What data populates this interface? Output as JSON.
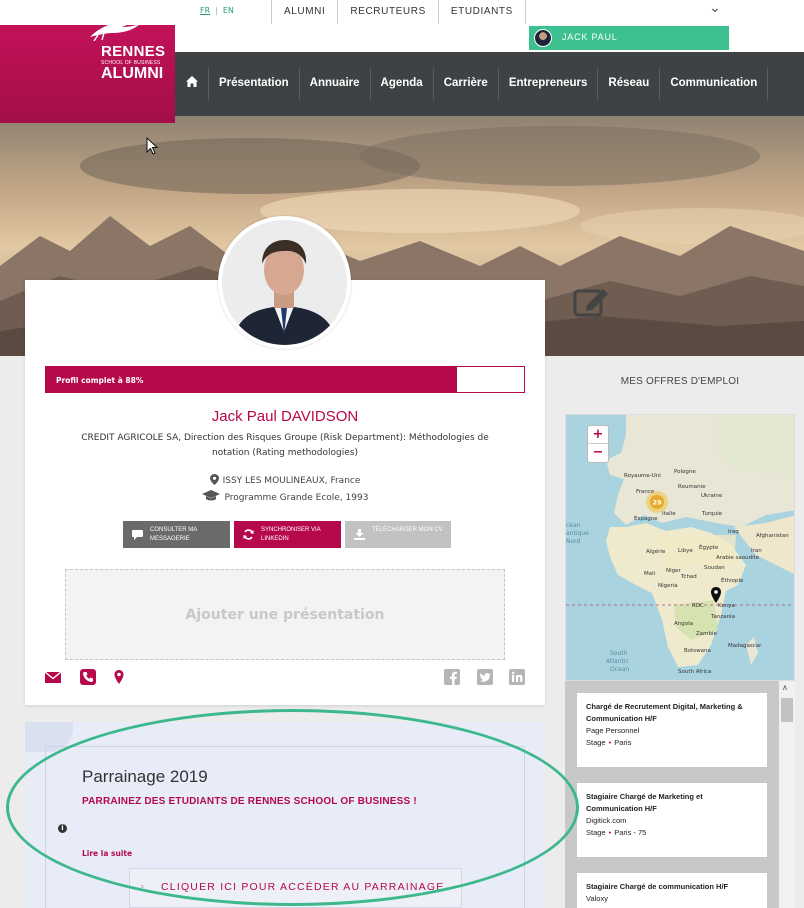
{
  "lang": {
    "fr": "FR",
    "sep": "|",
    "en": "EN"
  },
  "topnav": [
    "ALUMNI",
    "RECRUTEURS",
    "ETUDIANTS"
  ],
  "user": {
    "name": "JACK PAUL"
  },
  "logo": {
    "line1": "RENNES",
    "line2": "SCHOOL OF BUSINESS",
    "line3": "ALUMNI"
  },
  "mainnav": {
    "home_icon": "home-icon",
    "items": [
      "Présentation",
      "Annuaire",
      "Agenda",
      "Carrière",
      "Entrepreneurs",
      "Réseau",
      "Communication"
    ]
  },
  "profile": {
    "completion_label": "Profil complet à 88%",
    "completion": 0.86,
    "name": "Jack Paul DAVIDSON",
    "job": "CREDIT AGRICOLE SA, Direction des Risques Groupe (Risk Department): Méthodologies de notation (Rating methodologies)",
    "location": "ISSY LES MOULINEAUX, France",
    "program": "Programme Grande Ecole, 1993",
    "buttons": {
      "messagerie": "CONSULTER MA MESSAGERIE",
      "linkedin": "SYNCHRONISER VIA LINKEDIN",
      "cv": "TÉLÉCHARGER MON CV"
    },
    "add_presentation": "Ajouter une présentation"
  },
  "parrainage": {
    "title": "Parrainage 2019",
    "subtitle": "PARRAINEZ DES ETUDIANTS DE RENNES SCHOOL OF BUSINESS !",
    "info_icon": "i",
    "read_more": "Lire la suite",
    "cta": "CLIQUER ICI POUR ACCÉDER AU PARRAINAGE"
  },
  "jobs": {
    "heading": "MES OFFRES D'EMPLOI",
    "map": {
      "zoom_in": "+",
      "zoom_out": "−",
      "cluster_count": "29",
      "labels": [
        "Royaume-Uni",
        "Pologne",
        "Ukraine",
        "France",
        "Roumanie",
        "Espagne",
        "Turquie",
        "Italie",
        "Afghanistan",
        "Iraq",
        "Iran",
        "Algérie",
        "Libye",
        "Égypte",
        "Arabie saoudite",
        "Mali",
        "Niger",
        "Soudan",
        "Nigeria",
        "Tchad",
        "Éthiopie",
        "RDC",
        "Kenya",
        "Tanzania",
        "Angola",
        "Zambie",
        "Botswana",
        "Madagascar",
        "South Africa",
        "Océan Atlantique Nord",
        "South Atlantic Ocean"
      ]
    },
    "items": [
      {
        "title": "Chargé de Recrutement Digital, Marketing & Communication H/F",
        "company": "Page Personnel",
        "type": "Stage",
        "place": "Paris"
      },
      {
        "title": "Stagiaire Chargé de Marketing et Communication H/F",
        "company": "Digitick.com",
        "type": "Stage",
        "place": "Paris - 75"
      },
      {
        "title": "Stagiaire Chargé de communication H/F",
        "company": "Valoxy",
        "type": "",
        "place": ""
      }
    ]
  },
  "colors": {
    "brand": "#b5094c",
    "nav": "#3f4244",
    "user_bar": "#3cc08f",
    "highlight": "#3db88d"
  }
}
